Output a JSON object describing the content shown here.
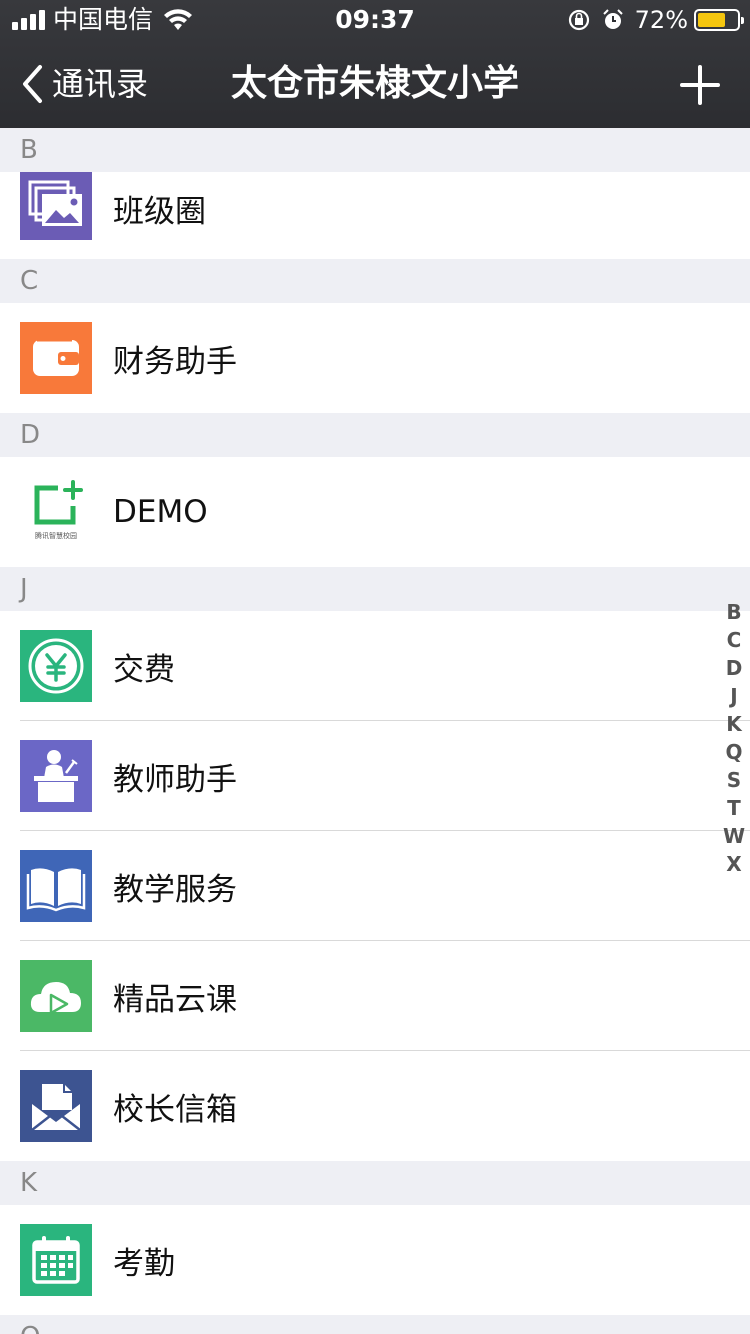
{
  "status_bar": {
    "carrier": "中国电信",
    "time": "09:37",
    "battery_percent": "72%",
    "battery_level": 0.72,
    "battery_color": "#f5c60f",
    "icons": [
      "signal-icon",
      "wifi-icon",
      "rotation-lock-icon",
      "alarm-icon",
      "battery-icon"
    ]
  },
  "nav": {
    "back_label": "通讯录",
    "title": "太仓市朱棣文小学",
    "add_icon": "plus-icon"
  },
  "sections": [
    {
      "letter": "B",
      "items": [
        {
          "label": "班级圈",
          "icon": "photo-gallery-icon",
          "color": "#6b5cb5"
        }
      ]
    },
    {
      "letter": "C",
      "items": [
        {
          "label": "财务助手",
          "icon": "wallet-icon",
          "color": "#f8793a"
        }
      ]
    },
    {
      "letter": "D",
      "items": [
        {
          "label": "DEMO",
          "icon": "demo-logo-icon",
          "color": "#2bb35a",
          "logo_text": "腾讯智慧校园"
        }
      ]
    },
    {
      "letter": "J",
      "items": [
        {
          "label": "交费",
          "icon": "yuan-coin-icon",
          "color": "#2ab57e"
        },
        {
          "label": "教师助手",
          "icon": "teacher-icon",
          "color": "#6b67c6"
        },
        {
          "label": "教学服务",
          "icon": "open-book-icon",
          "color": "#3f66b7"
        },
        {
          "label": "精品云课",
          "icon": "cloud-play-icon",
          "color": "#4bb866"
        },
        {
          "label": "校长信箱",
          "icon": "mailbox-icon",
          "color": "#3d5491"
        }
      ]
    },
    {
      "letter": "K",
      "items": [
        {
          "label": "考勤",
          "icon": "calendar-icon",
          "color": "#2ab57e"
        }
      ]
    },
    {
      "letter": "Q",
      "items": []
    }
  ],
  "index_letters": [
    "B",
    "C",
    "D",
    "J",
    "K",
    "Q",
    "S",
    "T",
    "W",
    "X"
  ]
}
